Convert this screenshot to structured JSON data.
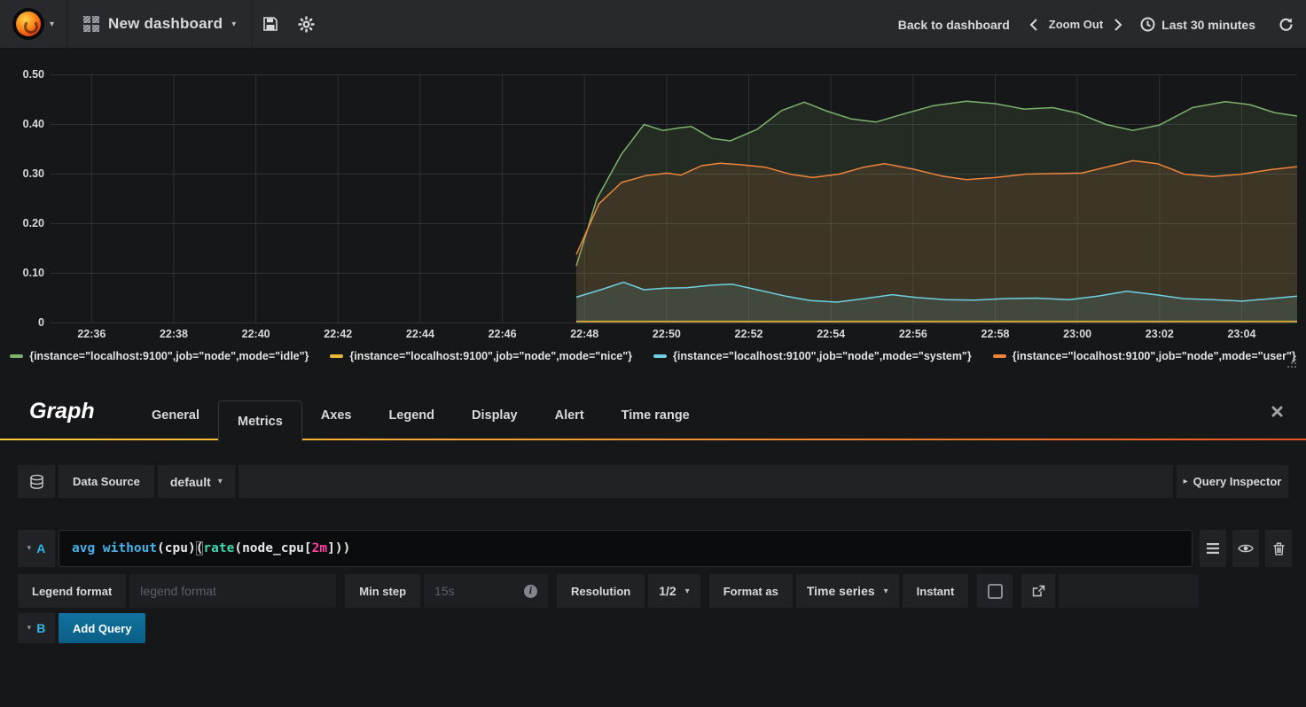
{
  "navbar": {
    "dashboard_title": "New dashboard",
    "back_to_dashboard": "Back to dashboard",
    "zoom_out": "Zoom Out",
    "time_range": "Last 30 minutes"
  },
  "graph_panel": {
    "legend": [
      {
        "label": "{instance=\"localhost:9100\",job=\"node\",mode=\"idle\"}",
        "color": "#7eb26d"
      },
      {
        "label": "{instance=\"localhost:9100\",job=\"node\",mode=\"nice\"}",
        "color": "#eab839"
      },
      {
        "label": "{instance=\"localhost:9100\",job=\"node\",mode=\"system\"}",
        "color": "#6ed0e0"
      },
      {
        "label": "{instance=\"localhost:9100\",job=\"node\",mode=\"user\"}",
        "color": "#ef843c"
      }
    ]
  },
  "chart_data": {
    "type": "area",
    "title": "",
    "x_domain_minutes_from_2235": [
      0,
      30.35
    ],
    "y_domain": [
      0,
      0.5
    ],
    "grid": true,
    "legend_position": "bottom",
    "x_ticks": [
      {
        "t": 1,
        "label": "22:36"
      },
      {
        "t": 3,
        "label": "22:38"
      },
      {
        "t": 5,
        "label": "22:40"
      },
      {
        "t": 7,
        "label": "22:42"
      },
      {
        "t": 9,
        "label": "22:44"
      },
      {
        "t": 11,
        "label": "22:46"
      },
      {
        "t": 13,
        "label": "22:48"
      },
      {
        "t": 15,
        "label": "22:50"
      },
      {
        "t": 17,
        "label": "22:52"
      },
      {
        "t": 19,
        "label": "22:54"
      },
      {
        "t": 21,
        "label": "22:56"
      },
      {
        "t": 23,
        "label": "22:58"
      },
      {
        "t": 25,
        "label": "23:00"
      },
      {
        "t": 27,
        "label": "23:02"
      },
      {
        "t": 29,
        "label": "23:04"
      }
    ],
    "y_ticks": [
      {
        "v": 0,
        "label": "0"
      },
      {
        "v": 0.1,
        "label": "0.10"
      },
      {
        "v": 0.2,
        "label": "0.20"
      },
      {
        "v": 0.3,
        "label": "0.30"
      },
      {
        "v": 0.4,
        "label": "0.40"
      },
      {
        "v": 0.5,
        "label": "0.50"
      }
    ],
    "series": [
      {
        "name": "{instance=\"localhost:9100\",job=\"node\",mode=\"idle\"}",
        "color": "#7eb26d",
        "fill_opacity": 0.13,
        "points": [
          [
            12.8,
            0.115
          ],
          [
            13.3,
            0.25
          ],
          [
            13.9,
            0.34
          ],
          [
            14.45,
            0.4
          ],
          [
            14.9,
            0.388
          ],
          [
            15.3,
            0.393
          ],
          [
            15.6,
            0.396
          ],
          [
            16.1,
            0.372
          ],
          [
            16.55,
            0.367
          ],
          [
            17.2,
            0.39
          ],
          [
            17.8,
            0.428
          ],
          [
            18.35,
            0.445
          ],
          [
            18.9,
            0.427
          ],
          [
            19.5,
            0.411
          ],
          [
            20.1,
            0.405
          ],
          [
            20.8,
            0.422
          ],
          [
            21.5,
            0.438
          ],
          [
            22.3,
            0.447
          ],
          [
            23.0,
            0.442
          ],
          [
            23.7,
            0.431
          ],
          [
            24.4,
            0.434
          ],
          [
            25.0,
            0.423
          ],
          [
            25.7,
            0.4
          ],
          [
            26.35,
            0.388
          ],
          [
            27.0,
            0.399
          ],
          [
            27.8,
            0.434
          ],
          [
            28.6,
            0.446
          ],
          [
            29.2,
            0.44
          ],
          [
            29.8,
            0.424
          ],
          [
            30.35,
            0.417
          ]
        ]
      },
      {
        "name": "{instance=\"localhost:9100\",job=\"node\",mode=\"user\"}",
        "color": "#ef843c",
        "fill_opacity": 0.13,
        "points": [
          [
            12.8,
            0.138
          ],
          [
            13.35,
            0.24
          ],
          [
            13.9,
            0.283
          ],
          [
            14.5,
            0.297
          ],
          [
            15.0,
            0.302
          ],
          [
            15.35,
            0.298
          ],
          [
            15.85,
            0.317
          ],
          [
            16.3,
            0.322
          ],
          [
            16.8,
            0.319
          ],
          [
            17.4,
            0.314
          ],
          [
            18.0,
            0.3
          ],
          [
            18.55,
            0.293
          ],
          [
            19.2,
            0.3
          ],
          [
            19.8,
            0.314
          ],
          [
            20.3,
            0.321
          ],
          [
            21.0,
            0.31
          ],
          [
            21.7,
            0.296
          ],
          [
            22.3,
            0.289
          ],
          [
            23.0,
            0.293
          ],
          [
            23.75,
            0.3
          ],
          [
            24.5,
            0.301
          ],
          [
            25.1,
            0.302
          ],
          [
            25.75,
            0.315
          ],
          [
            26.35,
            0.327
          ],
          [
            26.95,
            0.321
          ],
          [
            27.6,
            0.3
          ],
          [
            28.3,
            0.295
          ],
          [
            29.0,
            0.3
          ],
          [
            29.7,
            0.309
          ],
          [
            30.35,
            0.315
          ]
        ]
      },
      {
        "name": "{instance=\"localhost:9100\",job=\"node\",mode=\"system\"}",
        "color": "#6ed0e0",
        "fill_opacity": 0.12,
        "points": [
          [
            12.8,
            0.052
          ],
          [
            13.4,
            0.067
          ],
          [
            13.95,
            0.082
          ],
          [
            14.45,
            0.067
          ],
          [
            14.95,
            0.07
          ],
          [
            15.5,
            0.071
          ],
          [
            16.1,
            0.076
          ],
          [
            16.6,
            0.078
          ],
          [
            17.2,
            0.067
          ],
          [
            17.9,
            0.054
          ],
          [
            18.5,
            0.045
          ],
          [
            19.15,
            0.042
          ],
          [
            19.8,
            0.049
          ],
          [
            20.5,
            0.057
          ],
          [
            21.1,
            0.051
          ],
          [
            21.8,
            0.047
          ],
          [
            22.5,
            0.046
          ],
          [
            23.2,
            0.049
          ],
          [
            24.0,
            0.05
          ],
          [
            24.8,
            0.047
          ],
          [
            25.5,
            0.054
          ],
          [
            26.2,
            0.064
          ],
          [
            26.9,
            0.057
          ],
          [
            27.6,
            0.049
          ],
          [
            28.3,
            0.047
          ],
          [
            29.0,
            0.044
          ],
          [
            29.7,
            0.049
          ],
          [
            30.35,
            0.054
          ]
        ]
      },
      {
        "name": "{instance=\"localhost:9100\",job=\"node\",mode=\"nice\"}",
        "color": "#eab839",
        "fill_opacity": 0.12,
        "points": [
          [
            12.8,
            0.003
          ],
          [
            30.35,
            0.003
          ]
        ]
      }
    ]
  },
  "editor": {
    "panel_type": "Graph",
    "tabs": [
      "General",
      "Metrics",
      "Axes",
      "Legend",
      "Display",
      "Alert",
      "Time range"
    ],
    "active_tab": "Metrics",
    "datasource": {
      "label": "Data Source",
      "value": "default"
    },
    "query_inspector_label": "Query Inspector",
    "query_a": {
      "letter": "A",
      "expression": "avg without(cpu) (rate(node_cpu[2m]))",
      "expr_tokens": [
        {
          "text": "avg without",
          "type": "keyword"
        },
        {
          "text": "(cpu) ",
          "type": "plain"
        },
        {
          "text": "(",
          "type": "paren-match"
        },
        {
          "text": "rate",
          "type": "function"
        },
        {
          "text": "(node_cpu[",
          "type": "plain"
        },
        {
          "text": "2m",
          "type": "duration"
        },
        {
          "text": "]))",
          "type": "plain"
        }
      ]
    },
    "options": {
      "legend_format_label": "Legend format",
      "legend_format_placeholder": "legend format",
      "min_step_label": "Min step",
      "min_step_placeholder": "15s",
      "resolution_label": "Resolution",
      "resolution_value": "1/2",
      "format_as_label": "Format as",
      "format_as_value": "Time series",
      "instant_label": "Instant"
    },
    "query_b": {
      "letter": "B",
      "add_query_label": "Add Query"
    }
  }
}
